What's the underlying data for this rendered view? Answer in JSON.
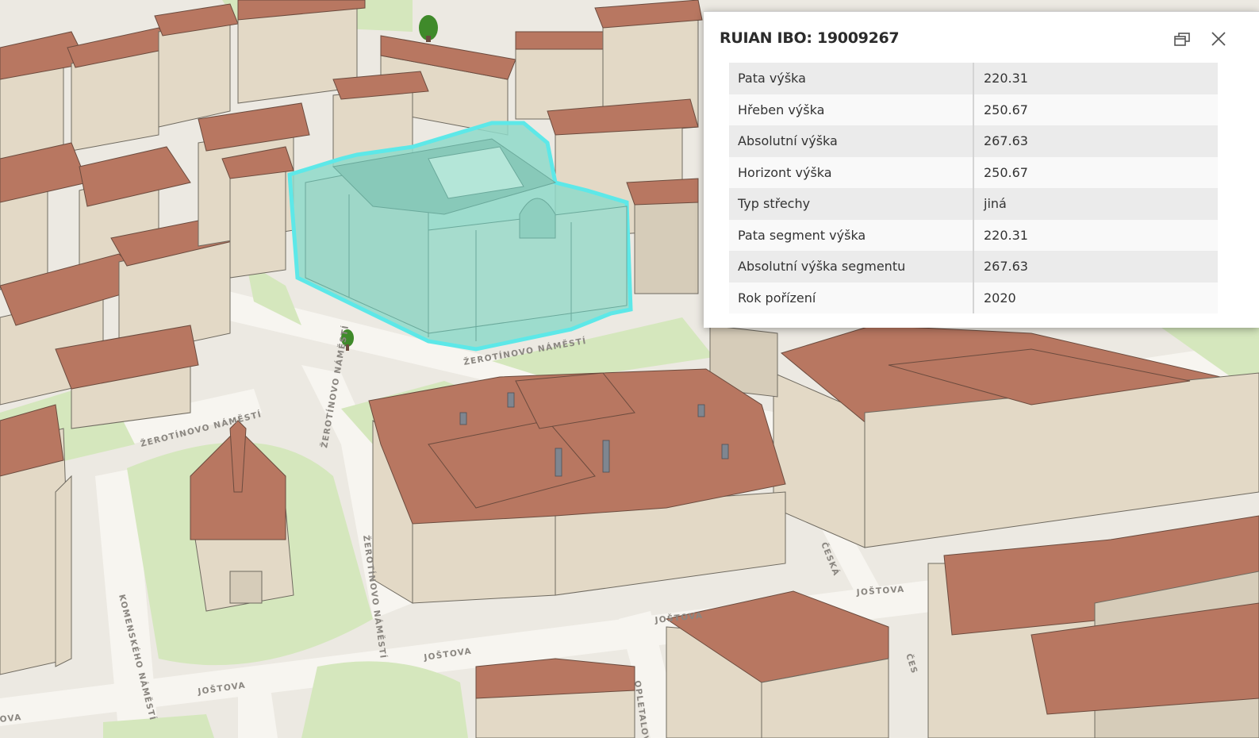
{
  "popup": {
    "title": "RUIAN IBO: 19009267",
    "rows": [
      {
        "label": "Pata výška",
        "value": "220.31"
      },
      {
        "label": "Hřeben výška",
        "value": "250.67"
      },
      {
        "label": "Absolutní výška",
        "value": "267.63"
      },
      {
        "label": "Horizont výška",
        "value": "250.67"
      },
      {
        "label": "Typ střechy",
        "value": "jiná"
      },
      {
        "label": "Pata segment výška",
        "value": "220.31"
      },
      {
        "label": "Absolutní výška segmentu",
        "value": "267.63"
      },
      {
        "label": "Rok pořízení",
        "value": "2020"
      }
    ],
    "icons": {
      "dock": "dock-icon",
      "close": "close-icon"
    }
  },
  "streets": {
    "zerotinovo_1": "ŽEROTÍNOVO NÁMĚSTÍ",
    "zerotinovo_2": "ŽEROTÍNOVO NÁMĚSTÍ",
    "zerotinovo_3": "ŽEROTÍNOVO NÁMĚSTÍ",
    "zerotinovo_4": "ŽEROTÍNOVO NÁMĚSTÍ",
    "komenskeho": "KOMENSKÉHO NÁMĚSTÍ",
    "jostova_1": "JOŠTOVA",
    "jostova_2": "JOŠTOVA",
    "jostova_3": "JOŠTOVA",
    "jostova_4": "JOŠTOVA",
    "ceska_1": "ČESKÁ",
    "ceska_2": "ČES",
    "opletalova": "OPLETALOV",
    "ova": "OVA"
  },
  "colors": {
    "highlight": "#5de8e8",
    "highlight_fill": "#8fd9c9",
    "roof": "#b87761",
    "wall": "#e3d9c6",
    "park": "#d5e7bd",
    "street": "#f7f5f0"
  }
}
